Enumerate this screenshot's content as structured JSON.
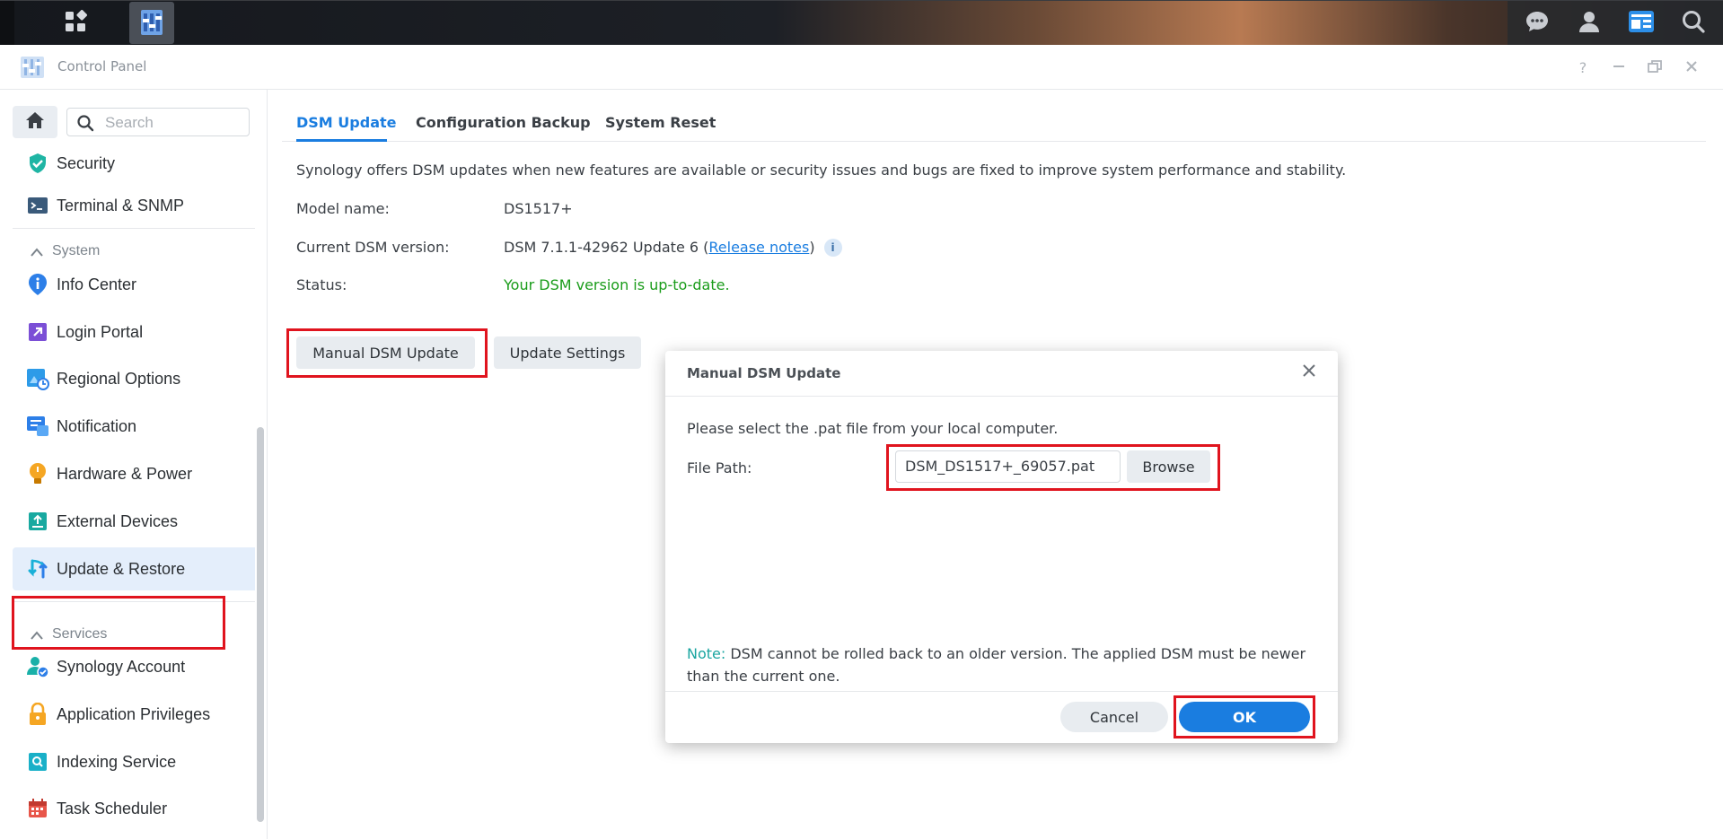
{
  "taskbar": {
    "left_icons": [
      "main-menu-icon",
      "control-panel-app-icon"
    ],
    "right_icons": [
      "chat-icon",
      "user-icon",
      "widgets-icon",
      "search-icon"
    ]
  },
  "window": {
    "title": "Control Panel",
    "controls": [
      "help-icon",
      "minimize-icon",
      "maximize-icon",
      "close-icon"
    ]
  },
  "sidebar": {
    "search_placeholder": "Search",
    "items_top": [
      {
        "label": "Security",
        "icon": "shield-icon"
      },
      {
        "label": "Terminal & SNMP",
        "icon": "terminal-icon"
      }
    ],
    "section_system": "System",
    "items_system": [
      {
        "label": "Info Center",
        "icon": "info-icon"
      },
      {
        "label": "Login Portal",
        "icon": "login-portal-icon"
      },
      {
        "label": "Regional Options",
        "icon": "regional-options-icon"
      },
      {
        "label": "Notification",
        "icon": "notification-icon"
      },
      {
        "label": "Hardware & Power",
        "icon": "hardware-power-icon"
      },
      {
        "label": "External Devices",
        "icon": "external-devices-icon"
      },
      {
        "label": "Update & Restore",
        "icon": "update-restore-icon"
      }
    ],
    "section_services": "Services",
    "items_services": [
      {
        "label": "Synology Account",
        "icon": "synology-account-icon"
      },
      {
        "label": "Application Privileges",
        "icon": "lock-icon"
      },
      {
        "label": "Indexing Service",
        "icon": "indexing-icon"
      },
      {
        "label": "Task Scheduler",
        "icon": "calendar-icon"
      }
    ]
  },
  "main": {
    "tabs": [
      "DSM Update",
      "Configuration Backup",
      "System Reset"
    ],
    "description": "Synology offers DSM updates when new features are available or security issues and bugs are fixed to improve system performance and stability.",
    "model_label": "Model name:",
    "model_value": "DS1517+",
    "version_label": "Current DSM version:",
    "version_value": "DSM 7.1.1-42962 Update 6 (",
    "release_notes_link": "Release notes",
    "version_suffix": ")",
    "status_label": "Status:",
    "status_value": "Your DSM version is up-to-date.",
    "manual_update_button": "Manual DSM Update",
    "update_settings_button": "Update Settings"
  },
  "dialog": {
    "title": "Manual DSM Update",
    "instruction": "Please select the .pat file from your local computer.",
    "file_path_label": "File Path:",
    "file_path_value": "DSM_DS1517+_69057.pat",
    "browse_button": "Browse",
    "note_prefix": "Note:",
    "note_text": " DSM cannot be rolled back to an older version. The applied DSM must be newer than the current one.",
    "cancel_button": "Cancel",
    "ok_button": "OK"
  },
  "colors": {
    "accent": "#1a7de0",
    "status_ok": "#1a9c1a",
    "highlight_box": "#e0141e",
    "note_prefix": "#1aa5a0"
  }
}
